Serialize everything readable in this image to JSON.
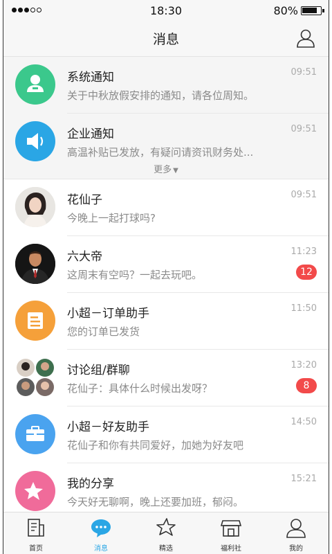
{
  "status_bar": {
    "time": "18:30",
    "battery": "80%"
  },
  "header": {
    "title": "消息"
  },
  "system_group": {
    "items": [
      {
        "name": "系统通知",
        "preview": "关于中秋放假安排的通知，请各位周知。",
        "time": "09:51",
        "icon": "person-badge-icon",
        "color": "#3bc88c"
      },
      {
        "name": "企业通知",
        "preview": "高温补贴已发放，有疑问请资讯财务处...",
        "time": "09:51",
        "icon": "speaker-icon",
        "color": "#2aa6e5"
      }
    ],
    "more_label": "更多"
  },
  "chats": [
    {
      "name": "花仙子",
      "preview": "今晚上一起打球吗?",
      "time": "09:51",
      "badge": ""
    },
    {
      "name": "六大帝",
      "preview": "这周末有空吗？一起去玩吧。",
      "time": "11:23",
      "badge": "12"
    },
    {
      "name": "小超－订单助手",
      "preview": "您的订单已发货",
      "time": "11:50",
      "badge": "",
      "color": "#f5a03a"
    },
    {
      "name": "讨论组/群聊",
      "preview": "花仙子：具体什么时候出发呀？",
      "time": "13:20",
      "badge": "8"
    },
    {
      "name": "小超－好友助手",
      "preview": "花仙子和你有共同爱好，加她为好友吧",
      "time": "14:50",
      "badge": "",
      "color": "#4aa3ef"
    },
    {
      "name": "我的分享",
      "preview": "今天好无聊啊，晚上还要加班，郁闷。",
      "time": "15:21",
      "badge": "",
      "color": "#f06b9a"
    }
  ],
  "tabs": [
    {
      "label": "首页",
      "icon": "home-doc-icon"
    },
    {
      "label": "消息",
      "icon": "chat-bubble-icon",
      "active": true
    },
    {
      "label": "精选",
      "icon": "star-icon"
    },
    {
      "label": "福利社",
      "icon": "shop-icon"
    },
    {
      "label": "我的",
      "icon": "user-icon"
    }
  ],
  "colors": {
    "accent": "#2aa6e5",
    "badge": "#f24a4a"
  }
}
